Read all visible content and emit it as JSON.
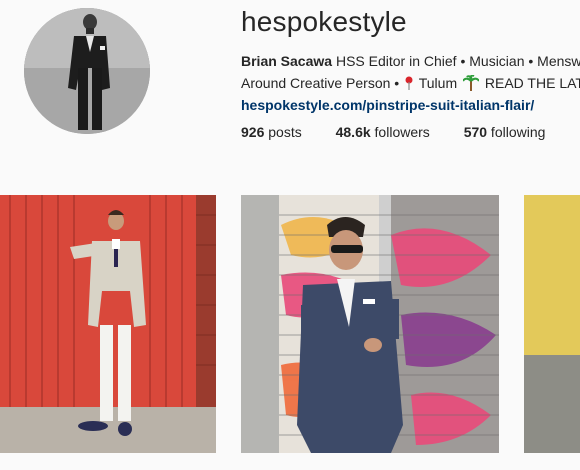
{
  "profile": {
    "username": "hespokestyle",
    "name": "Brian Sacawa",
    "bio_line1": " HSS Editor in Chief • Musician • Menswe",
    "bio_line2_a": "Around Creative Person • ",
    "bio_line2_b": " Tulum ",
    "bio_line2_c": " READ THE LAT",
    "link": "hespokestyle.com/pinstripe-suit-italian-flair/",
    "posts_count": "926",
    "posts_label": " posts",
    "followers_count": "48.6k",
    "followers_label": " followers",
    "following_count": "570",
    "following_label": " following"
  },
  "icons": [
    "pin-icon",
    "palm-tree-icon"
  ],
  "colors": {
    "link": "#003569",
    "red_door": "#d9483b",
    "graffiti_pink": "#e94a7a"
  }
}
